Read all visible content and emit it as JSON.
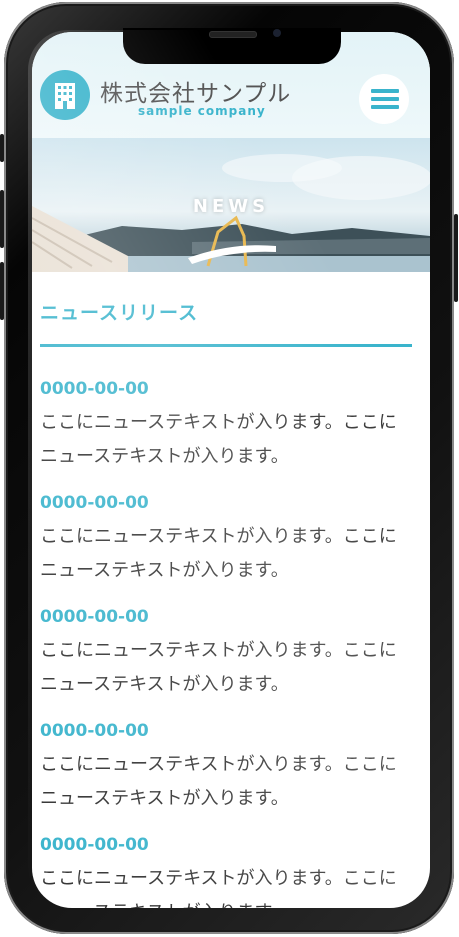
{
  "header": {
    "company_name": "株式会社サンプル",
    "company_sub": "sample company",
    "logo_icon": "building-icon",
    "menu_icon": "hamburger-menu-icon"
  },
  "hero": {
    "title": "NEWS"
  },
  "section": {
    "title": "ニュースリリース"
  },
  "news": [
    {
      "date": "0000-00-00",
      "text": "ここにニューステキストが入ります。ここにニューステキストが入ります。"
    },
    {
      "date": "0000-00-00",
      "text": "ここにニューステキストが入ります。ここにニューステキストが入ります。"
    },
    {
      "date": "0000-00-00",
      "text": "ここにニューステキストが入ります。ここにニューステキストが入ります。"
    },
    {
      "date": "0000-00-00",
      "text": "ここにニューステキストが入ります。ここにニューステキストが入ります。"
    },
    {
      "date": "0000-00-00",
      "text": "ここにニューステキストが入ります。ここにニューステキストが入ります。"
    }
  ],
  "colors": {
    "accent": "#3ab4cc",
    "text": "#333333"
  }
}
